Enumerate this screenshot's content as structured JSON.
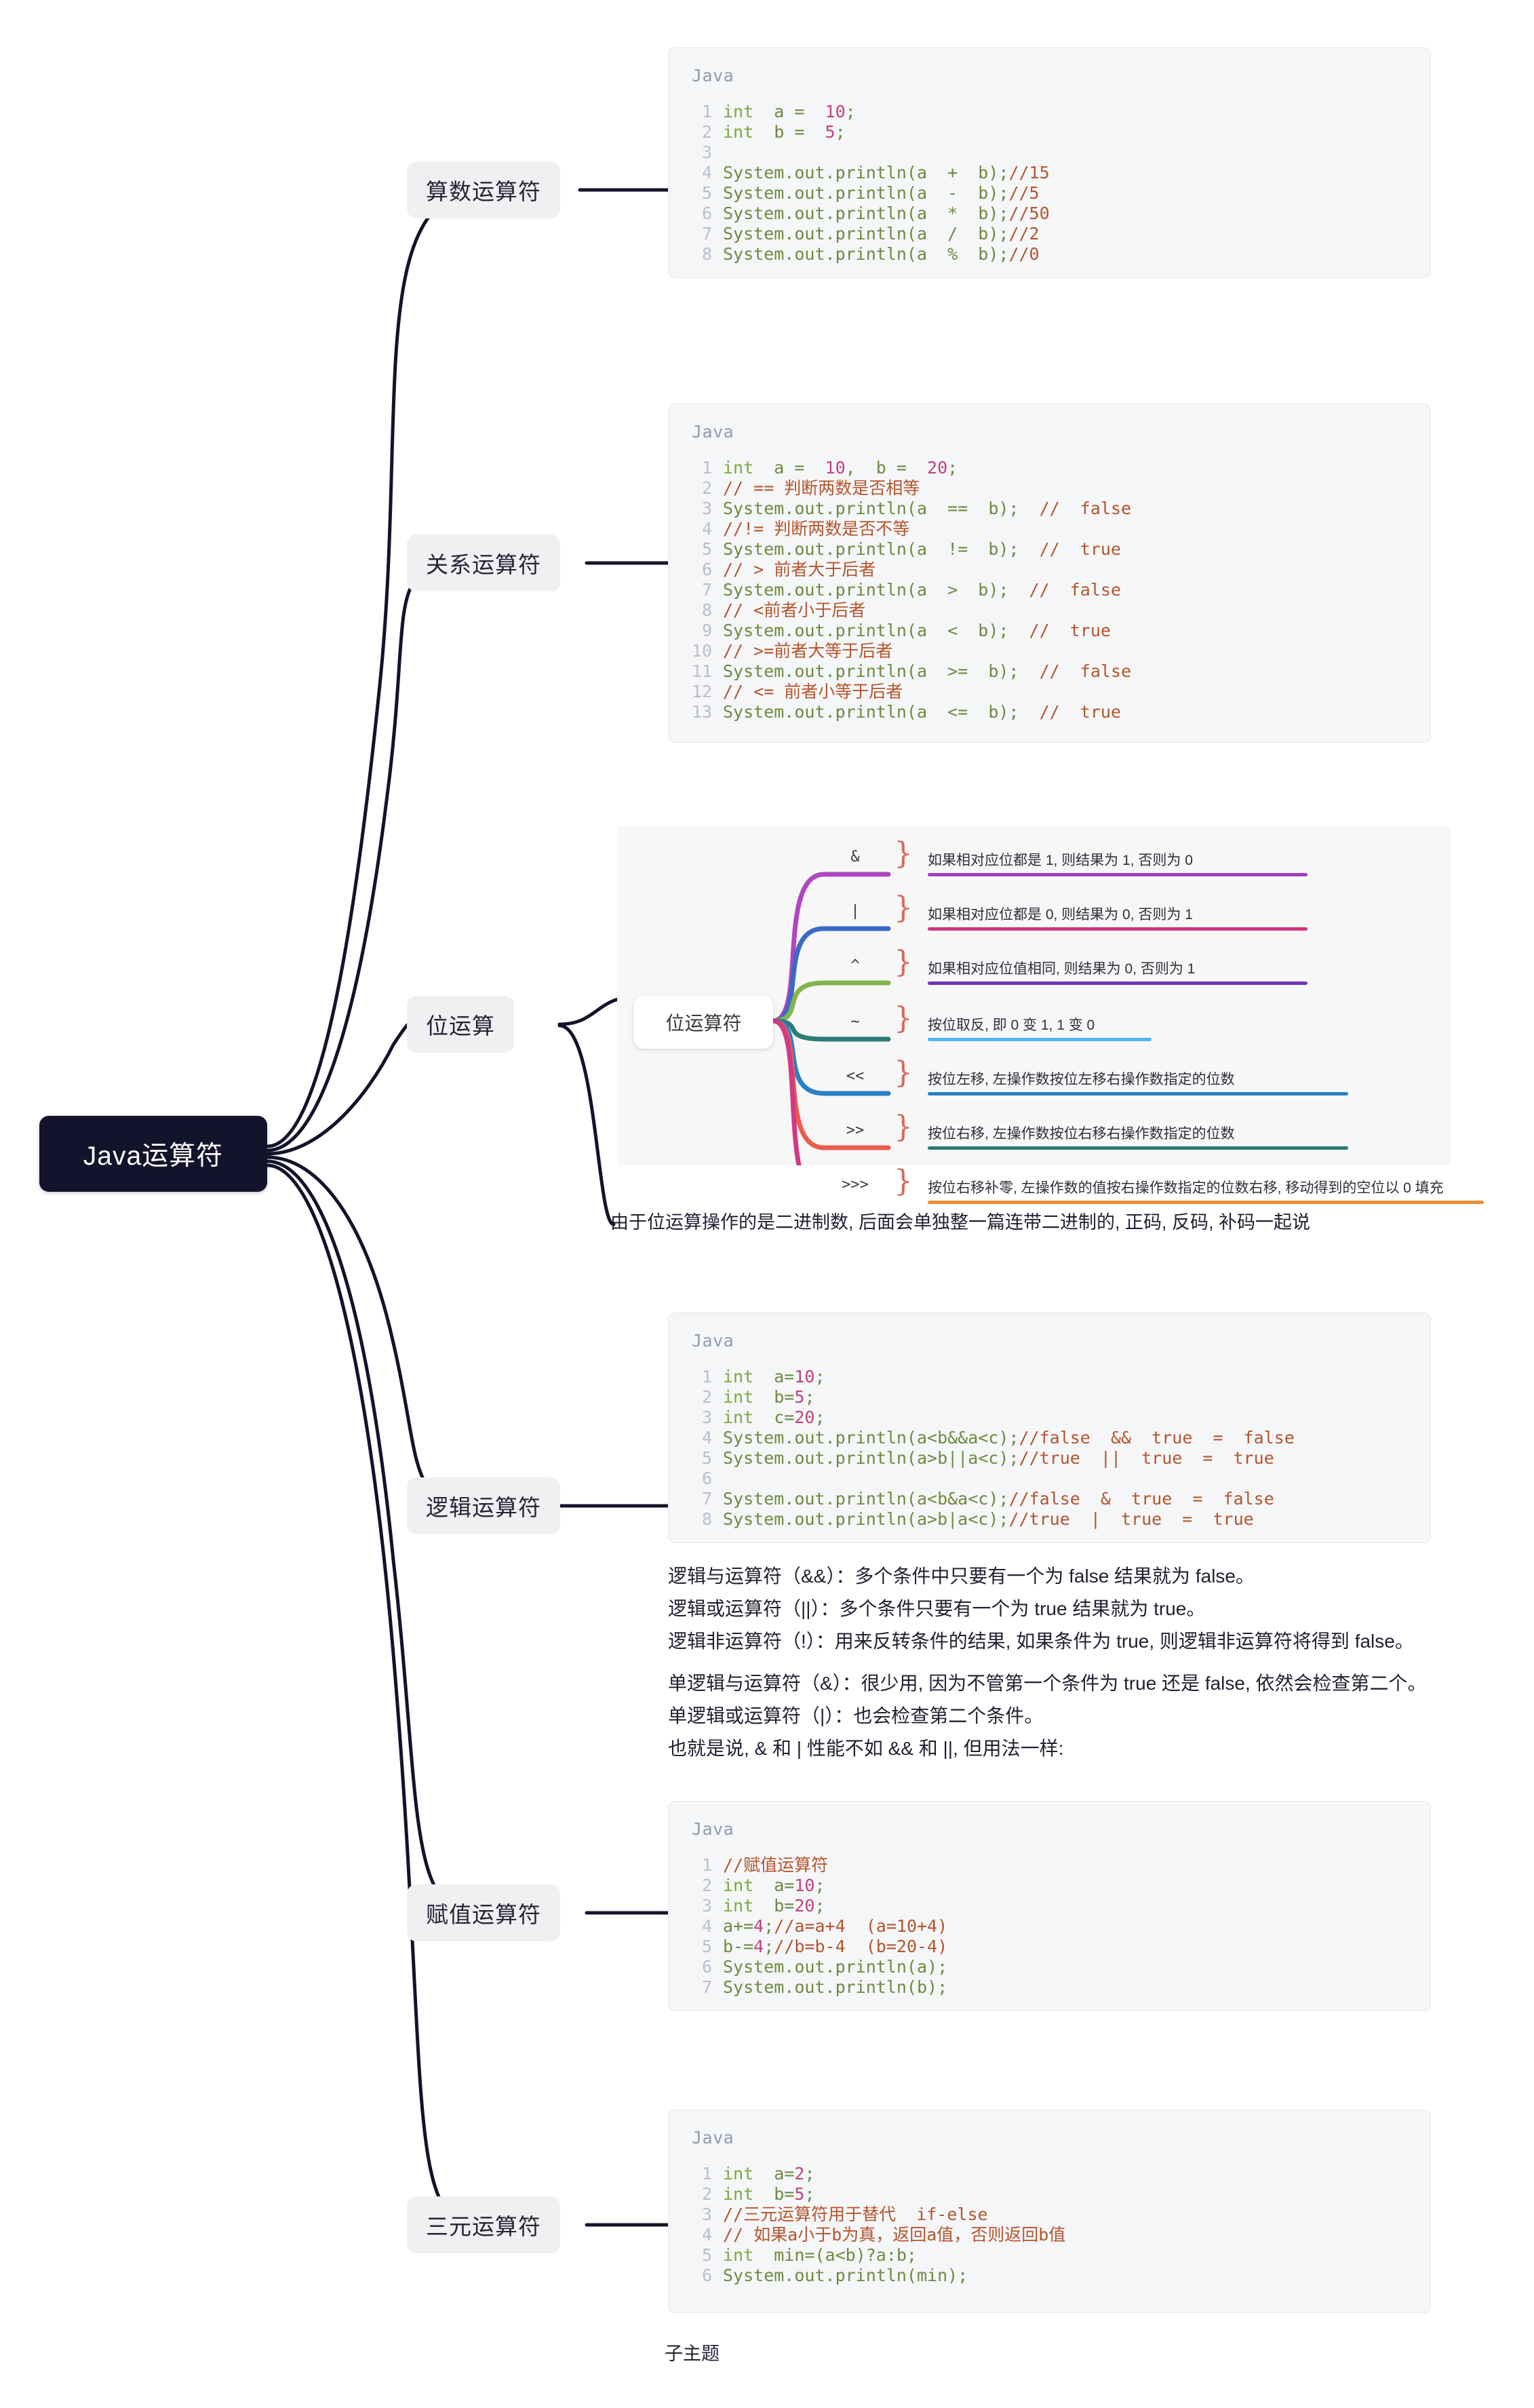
{
  "root": {
    "label": "Java运算符"
  },
  "branches": [
    {
      "label": "算数运算符"
    },
    {
      "label": "关系运算符"
    },
    {
      "label": "位运算"
    },
    {
      "label": "逻辑运算符"
    },
    {
      "label": "赋值运算符"
    },
    {
      "label": "三元运算符"
    }
  ],
  "code_blocks": {
    "arithmetic": {
      "lang": "Java",
      "lines": [
        {
          "n": "1",
          "text": "int  a =  10;"
        },
        {
          "n": "2",
          "text": "int  b =  5;"
        },
        {
          "n": "3",
          "text": ""
        },
        {
          "n": "4",
          "text": "System.out.println(a  +  b);//15"
        },
        {
          "n": "5",
          "text": "System.out.println(a  -  b);//5"
        },
        {
          "n": "6",
          "text": "System.out.println(a  *  b);//50"
        },
        {
          "n": "7",
          "text": "System.out.println(a  /  b);//2"
        },
        {
          "n": "8",
          "text": "System.out.println(a  %  b);//0"
        }
      ]
    },
    "relational": {
      "lang": "Java",
      "lines": [
        {
          "n": "1",
          "text": "int  a =  10,  b =  20;"
        },
        {
          "n": "2",
          "text": "// == 判断两数是否相等"
        },
        {
          "n": "3",
          "text": "System.out.println(a  ==  b);  //  false"
        },
        {
          "n": "4",
          "text": "//!= 判断两数是否不等"
        },
        {
          "n": "5",
          "text": "System.out.println(a  !=  b);  //  true"
        },
        {
          "n": "6",
          "text": "// > 前者大于后者"
        },
        {
          "n": "7",
          "text": "System.out.println(a  >  b);  //  false"
        },
        {
          "n": "8",
          "text": "// <前者小于后者"
        },
        {
          "n": "9",
          "text": "System.out.println(a  <  b);  //  true"
        },
        {
          "n": "10",
          "text": "// >=前者大等于后者"
        },
        {
          "n": "11",
          "text": "System.out.println(a  >=  b);  //  false"
        },
        {
          "n": "12",
          "text": "// <= 前者小等于后者"
        },
        {
          "n": "13",
          "text": "System.out.println(a  <=  b);  //  true"
        }
      ]
    },
    "logical": {
      "lang": "Java",
      "lines": [
        {
          "n": "1",
          "text": "int  a=10;"
        },
        {
          "n": "2",
          "text": "int  b=5;"
        },
        {
          "n": "3",
          "text": "int  c=20;"
        },
        {
          "n": "4",
          "text": "System.out.println(a<b&&a<c);//false  &&  true  =  false"
        },
        {
          "n": "5",
          "text": "System.out.println(a>b||a<c);//true  ||  true  =  true"
        },
        {
          "n": "6",
          "text": ""
        },
        {
          "n": "7",
          "text": "System.out.println(a<b&a<c);//false  &  true  =  false"
        },
        {
          "n": "8",
          "text": "System.out.println(a>b|a<c);//true  |  true  =  true"
        }
      ]
    },
    "assignment": {
      "lang": "Java",
      "lines": [
        {
          "n": "1",
          "text": "//赋值运算符"
        },
        {
          "n": "2",
          "text": "int  a=10;"
        },
        {
          "n": "3",
          "text": "int  b=20;"
        },
        {
          "n": "4",
          "text": "a+=4;//a=a+4  (a=10+4)"
        },
        {
          "n": "5",
          "text": "b-=4;//b=b-4  (b=20-4)"
        },
        {
          "n": "6",
          "text": "System.out.println(a);"
        },
        {
          "n": "7",
          "text": "System.out.println(b);"
        }
      ]
    },
    "ternary": {
      "lang": "Java",
      "lines": [
        {
          "n": "1",
          "text": "int  a=2;"
        },
        {
          "n": "2",
          "text": "int  b=5;"
        },
        {
          "n": "3",
          "text": "//三元运算符用于替代  if-else"
        },
        {
          "n": "4",
          "text": "// 如果a小于b为真，返回a值，否则返回b值"
        },
        {
          "n": "5",
          "text": "int  min=(a<b)?a:b;"
        },
        {
          "n": "6",
          "text": "System.out.println(min);"
        }
      ]
    }
  },
  "bitmap": {
    "center_label": "位运算符",
    "rows": [
      {
        "symbol": "&",
        "text": "如果相对应位都是 1, 则结果为 1, 否则为 0",
        "wire_color": "#b046c0",
        "underline_color": "#a13fc4",
        "underline_width": 560
      },
      {
        "symbol": "|",
        "text": "如果相对应位都是 0, 则结果为 0, 否则为 1",
        "wire_color": "#3a6bc4",
        "underline_color": "#d0357f",
        "underline_width": 560
      },
      {
        "symbol": "^",
        "text": "如果相对应位值相同, 则结果为 0, 否则为 1",
        "wire_color": "#84b54c",
        "underline_color": "#6b32c0",
        "underline_width": 560
      },
      {
        "symbol": "~",
        "text": "按位取反, 即 0 变 1, 1 变 0",
        "wire_color": "#2e7a77",
        "underline_color": "#4fb9ef",
        "underline_width": 330
      },
      {
        "symbol": "<<",
        "text": "按位左移, 左操作数按位左移右操作数指定的位数",
        "wire_color": "#2a81c4",
        "underline_color": "#2a81c4",
        "underline_width": 620
      },
      {
        "symbol": ">>",
        "text": "按位右移, 左操作数按位右移右操作数指定的位数",
        "wire_color": "#ee5a4c",
        "underline_color": "#2b7a78",
        "underline_width": 620
      },
      {
        "symbol": ">>>",
        "text": "按位右移补零, 左操作数的值按右操作数指定的位数右移, 移动得到的空位以 0 填充",
        "wire_color": "#d13a86",
        "underline_color": "#ef8a33",
        "underline_width": 820
      }
    ]
  },
  "notes": {
    "bitwise_note": "由于位运算操作的是二进制数, 后面会单独整一篇连带二进制的, 正码, 反码, 补码一起说",
    "logical_explain_1": "逻辑与运算符（&&）：多个条件中只要有一个为 false 结果就为 false。\n逻辑或运算符（||）：多个条件只要有一个为 true 结果就为 true。\n逻辑非运算符（!）：用来反转条件的结果, 如果条件为 true, 则逻辑非运算符将得到 false。",
    "logical_explain_2": "单逻辑与运算符（&）：很少用, 因为不管第一个条件为 true 还是 false, 依然会检查第二个。\n单逻辑或运算符（|）：也会检查第二个条件。\n也就是说, & 和 | 性能不如 && 和 ||, 但用法一样:",
    "subtopic": "子主题"
  }
}
